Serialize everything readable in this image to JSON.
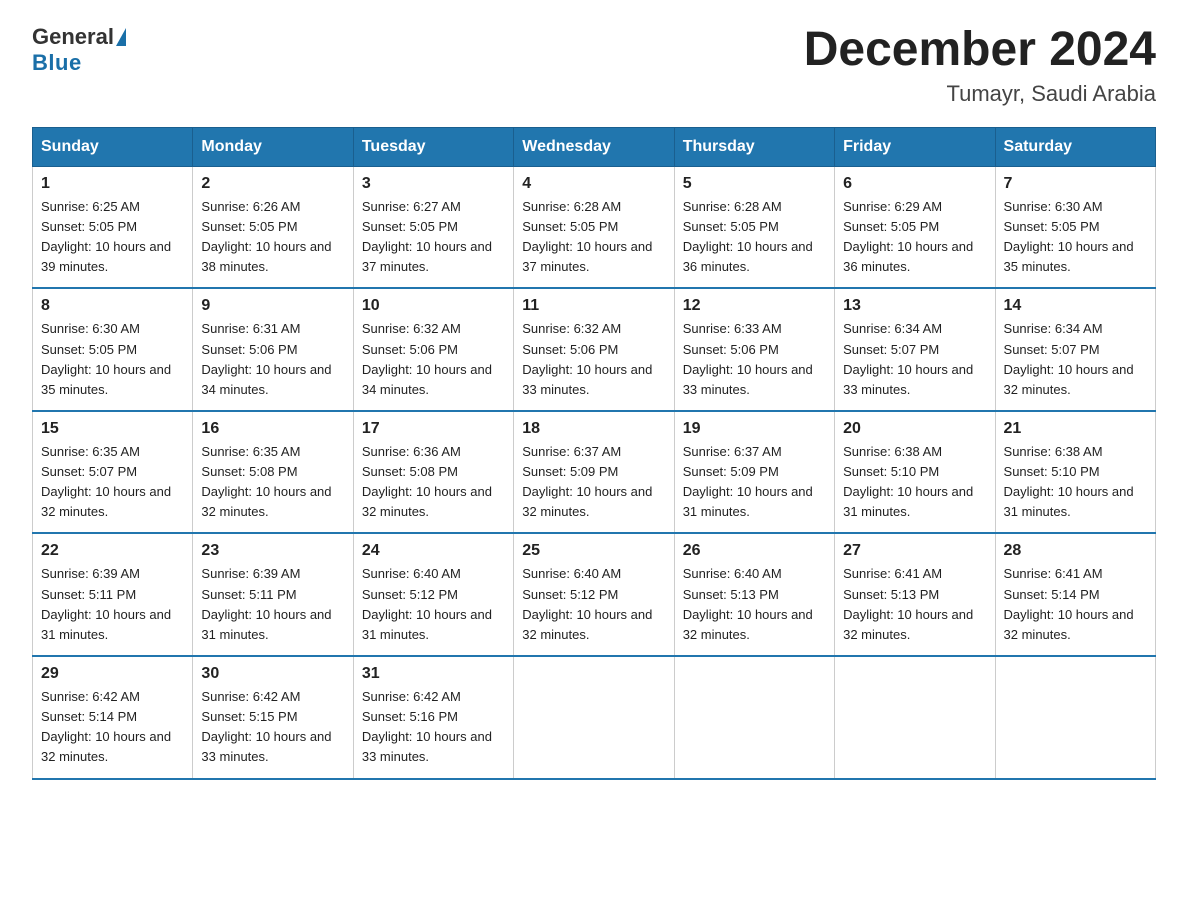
{
  "header": {
    "logo_general": "General",
    "logo_blue": "Blue",
    "title": "December 2024",
    "location": "Tumayr, Saudi Arabia"
  },
  "days_of_week": [
    "Sunday",
    "Monday",
    "Tuesday",
    "Wednesday",
    "Thursday",
    "Friday",
    "Saturday"
  ],
  "weeks": [
    [
      {
        "day": "1",
        "sunrise": "6:25 AM",
        "sunset": "5:05 PM",
        "daylight": "10 hours and 39 minutes."
      },
      {
        "day": "2",
        "sunrise": "6:26 AM",
        "sunset": "5:05 PM",
        "daylight": "10 hours and 38 minutes."
      },
      {
        "day": "3",
        "sunrise": "6:27 AM",
        "sunset": "5:05 PM",
        "daylight": "10 hours and 37 minutes."
      },
      {
        "day": "4",
        "sunrise": "6:28 AM",
        "sunset": "5:05 PM",
        "daylight": "10 hours and 37 minutes."
      },
      {
        "day": "5",
        "sunrise": "6:28 AM",
        "sunset": "5:05 PM",
        "daylight": "10 hours and 36 minutes."
      },
      {
        "day": "6",
        "sunrise": "6:29 AM",
        "sunset": "5:05 PM",
        "daylight": "10 hours and 36 minutes."
      },
      {
        "day": "7",
        "sunrise": "6:30 AM",
        "sunset": "5:05 PM",
        "daylight": "10 hours and 35 minutes."
      }
    ],
    [
      {
        "day": "8",
        "sunrise": "6:30 AM",
        "sunset": "5:05 PM",
        "daylight": "10 hours and 35 minutes."
      },
      {
        "day": "9",
        "sunrise": "6:31 AM",
        "sunset": "5:06 PM",
        "daylight": "10 hours and 34 minutes."
      },
      {
        "day": "10",
        "sunrise": "6:32 AM",
        "sunset": "5:06 PM",
        "daylight": "10 hours and 34 minutes."
      },
      {
        "day": "11",
        "sunrise": "6:32 AM",
        "sunset": "5:06 PM",
        "daylight": "10 hours and 33 minutes."
      },
      {
        "day": "12",
        "sunrise": "6:33 AM",
        "sunset": "5:06 PM",
        "daylight": "10 hours and 33 minutes."
      },
      {
        "day": "13",
        "sunrise": "6:34 AM",
        "sunset": "5:07 PM",
        "daylight": "10 hours and 33 minutes."
      },
      {
        "day": "14",
        "sunrise": "6:34 AM",
        "sunset": "5:07 PM",
        "daylight": "10 hours and 32 minutes."
      }
    ],
    [
      {
        "day": "15",
        "sunrise": "6:35 AM",
        "sunset": "5:07 PM",
        "daylight": "10 hours and 32 minutes."
      },
      {
        "day": "16",
        "sunrise": "6:35 AM",
        "sunset": "5:08 PM",
        "daylight": "10 hours and 32 minutes."
      },
      {
        "day": "17",
        "sunrise": "6:36 AM",
        "sunset": "5:08 PM",
        "daylight": "10 hours and 32 minutes."
      },
      {
        "day": "18",
        "sunrise": "6:37 AM",
        "sunset": "5:09 PM",
        "daylight": "10 hours and 32 minutes."
      },
      {
        "day": "19",
        "sunrise": "6:37 AM",
        "sunset": "5:09 PM",
        "daylight": "10 hours and 31 minutes."
      },
      {
        "day": "20",
        "sunrise": "6:38 AM",
        "sunset": "5:10 PM",
        "daylight": "10 hours and 31 minutes."
      },
      {
        "day": "21",
        "sunrise": "6:38 AM",
        "sunset": "5:10 PM",
        "daylight": "10 hours and 31 minutes."
      }
    ],
    [
      {
        "day": "22",
        "sunrise": "6:39 AM",
        "sunset": "5:11 PM",
        "daylight": "10 hours and 31 minutes."
      },
      {
        "day": "23",
        "sunrise": "6:39 AM",
        "sunset": "5:11 PM",
        "daylight": "10 hours and 31 minutes."
      },
      {
        "day": "24",
        "sunrise": "6:40 AM",
        "sunset": "5:12 PM",
        "daylight": "10 hours and 31 minutes."
      },
      {
        "day": "25",
        "sunrise": "6:40 AM",
        "sunset": "5:12 PM",
        "daylight": "10 hours and 32 minutes."
      },
      {
        "day": "26",
        "sunrise": "6:40 AM",
        "sunset": "5:13 PM",
        "daylight": "10 hours and 32 minutes."
      },
      {
        "day": "27",
        "sunrise": "6:41 AM",
        "sunset": "5:13 PM",
        "daylight": "10 hours and 32 minutes."
      },
      {
        "day": "28",
        "sunrise": "6:41 AM",
        "sunset": "5:14 PM",
        "daylight": "10 hours and 32 minutes."
      }
    ],
    [
      {
        "day": "29",
        "sunrise": "6:42 AM",
        "sunset": "5:14 PM",
        "daylight": "10 hours and 32 minutes."
      },
      {
        "day": "30",
        "sunrise": "6:42 AM",
        "sunset": "5:15 PM",
        "daylight": "10 hours and 33 minutes."
      },
      {
        "day": "31",
        "sunrise": "6:42 AM",
        "sunset": "5:16 PM",
        "daylight": "10 hours and 33 minutes."
      },
      null,
      null,
      null,
      null
    ]
  ]
}
